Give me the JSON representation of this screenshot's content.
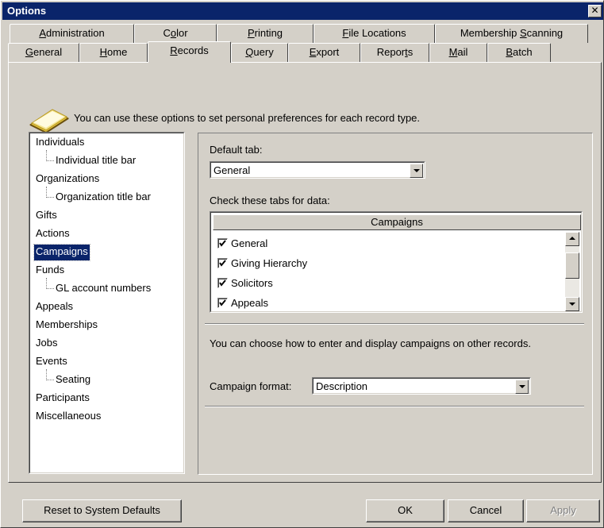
{
  "window": {
    "title": "Options",
    "close_glyph": "✕"
  },
  "tabs_row1": [
    {
      "label": "Administration",
      "accel": "A"
    },
    {
      "label": "Color",
      "accel": "o"
    },
    {
      "label": "Printing",
      "accel": "P"
    },
    {
      "label": "File Locations",
      "accel": "F"
    },
    {
      "label": "Membership Scanning",
      "accel": "S"
    }
  ],
  "tabs_row2": [
    {
      "label": "General",
      "accel": "G"
    },
    {
      "label": "Home",
      "accel": "H"
    },
    {
      "label": "Records",
      "accel": "R",
      "active": true
    },
    {
      "label": "Query",
      "accel": "Q"
    },
    {
      "label": "Export",
      "accel": "E"
    },
    {
      "label": "Reports",
      "accel": "t"
    },
    {
      "label": "Mail",
      "accel": "M"
    },
    {
      "label": "Batch",
      "accel": "B"
    }
  ],
  "intro": {
    "text": "You can use these options to set personal preferences for each record type.",
    "icon": "book-icon"
  },
  "tree": {
    "items": [
      {
        "label": "Individuals",
        "level": 0
      },
      {
        "label": "Individual title bar",
        "level": 1
      },
      {
        "label": "Organizations",
        "level": 0
      },
      {
        "label": "Organization title bar",
        "level": 1
      },
      {
        "label": "Gifts",
        "level": 0
      },
      {
        "label": "Actions",
        "level": 0
      },
      {
        "label": "Campaigns",
        "level": 0,
        "selected": true
      },
      {
        "label": "Funds",
        "level": 0
      },
      {
        "label": "GL account numbers",
        "level": 1
      },
      {
        "label": "Appeals",
        "level": 0
      },
      {
        "label": "Memberships",
        "level": 0
      },
      {
        "label": "Jobs",
        "level": 0
      },
      {
        "label": "Events",
        "level": 0
      },
      {
        "label": "Seating",
        "level": 1
      },
      {
        "label": "Participants",
        "level": 0
      },
      {
        "label": "Miscellaneous",
        "level": 0
      }
    ]
  },
  "settings": {
    "default_tab_label": "Default tab:",
    "default_tab_value": "General",
    "check_tabs_label": "Check these tabs for data:",
    "list_header": "Campaigns",
    "list_items": [
      {
        "label": "General",
        "checked": true
      },
      {
        "label": "Giving Hierarchy",
        "checked": true
      },
      {
        "label": "Solicitors",
        "checked": true
      },
      {
        "label": "Appeals",
        "checked": true
      }
    ],
    "format_help": "You can choose how to enter and display campaigns on other records.",
    "campaign_format_label": "Campaign format:",
    "campaign_format_value": "Description"
  },
  "buttons": {
    "reset": "Reset to System Defaults",
    "ok": "OK",
    "cancel": "Cancel",
    "apply": "Apply"
  },
  "colors": {
    "title_bg": "#0a246a",
    "face": "#d4d0c8",
    "selection": "#0a246a"
  }
}
